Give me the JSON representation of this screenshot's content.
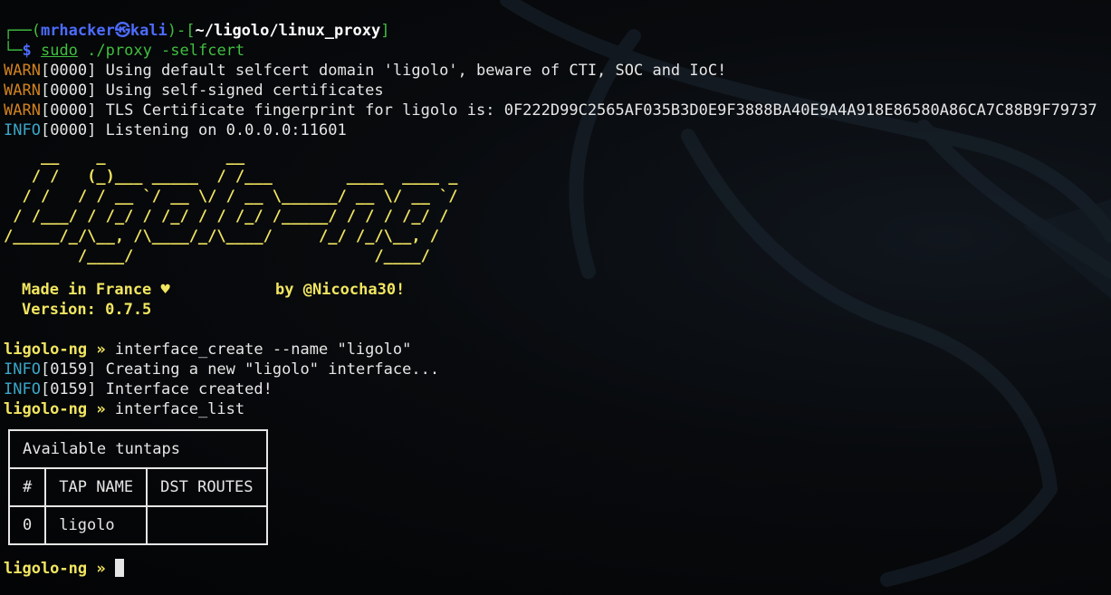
{
  "terminal": {
    "prompt": {
      "corner_top": "┌──(",
      "user_host": "mrhacker㉿kali",
      "sep": ")-[",
      "path": "~/ligolo/linux_proxy",
      "close": "]",
      "corner_bottom": "└─",
      "dollar": "$ ",
      "command_sudo": "sudo",
      "command_rest": " ./proxy -selfcert"
    },
    "logs_start": [
      {
        "level": "WARN",
        "stamp": "[0000] ",
        "msg": "Using default selfcert domain 'ligolo', beware of CTI, SOC and IoC!"
      },
      {
        "level": "WARN",
        "stamp": "[0000] ",
        "msg": "Using self-signed certificates"
      },
      {
        "level": "WARN",
        "stamp": "[0000] ",
        "msg": "TLS Certificate fingerprint for ligolo is: 0F222D99C2565AF035B3D0E9F3888BA40E9A4A918E86580A86CA7C88B9F79737"
      },
      {
        "level": "INFO",
        "stamp": "[0000] ",
        "msg": "Listening on 0.0.0.0:11601"
      }
    ],
    "ascii_logo": "    __    _             __                       \n   / /   (_)___ _____  / /___        ____  ____ _\n  / /   / / __ `/ __ \\/ / __ \\______/ __ \\/ __ `/\n / /___/ / /_/ / /_/ / / /_/ /_____/ / / / /_/ / \n/_____/_/\\__, /\\____/_/\\____/     /_/ /_/\\__, /  \n        /____/                          /____/   ",
    "banner_made_in": "Made in France ♥",
    "banner_by": "by @Nicocha30!",
    "banner_version": "Version: 0.7.5",
    "shell_prompt": "ligolo-ng » ",
    "cmd_interface_create": "interface_create --name \"ligolo\"",
    "logs_create": [
      {
        "level": "INFO",
        "stamp": "[0159] ",
        "msg": "Creating a new \"ligolo\" interface..."
      },
      {
        "level": "INFO",
        "stamp": "[0159] ",
        "msg": "Interface created!"
      }
    ],
    "cmd_interface_list": "interface_list",
    "table": {
      "title": "Available tuntaps",
      "headers": [
        "#",
        "TAP NAME",
        "DST ROUTES"
      ],
      "rows": [
        [
          "0",
          "ligolo",
          ""
        ]
      ]
    }
  },
  "colors": {
    "background": "#000000",
    "prompt_green": "#3fbf3f",
    "user_blue": "#4d6cff",
    "warn_orange": "#d1821e",
    "info_cyan": "#3aa7c9",
    "banner_yellow": "#f2e660"
  },
  "icons": {
    "watermark": "kali-dragon-icon",
    "cursor": "block-cursor"
  }
}
